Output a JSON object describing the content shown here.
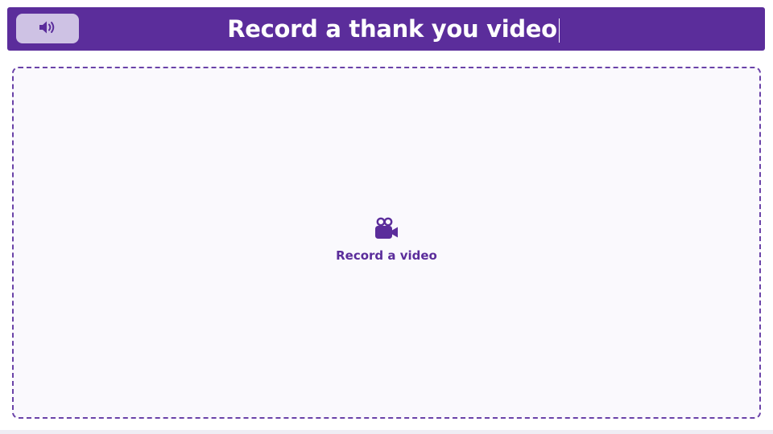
{
  "header": {
    "title": "Record a thank you video",
    "sound_icon": "speaker-volume-icon"
  },
  "dropzone": {
    "icon": "video-camera-icon",
    "label": "Record a video"
  },
  "colors": {
    "header_bg": "#5b2d9b",
    "sound_button_bg": "#cec2e4",
    "accent": "#5b2d9b",
    "dropzone_border": "#6a42a8",
    "dropzone_bg": "#faf9fd"
  }
}
